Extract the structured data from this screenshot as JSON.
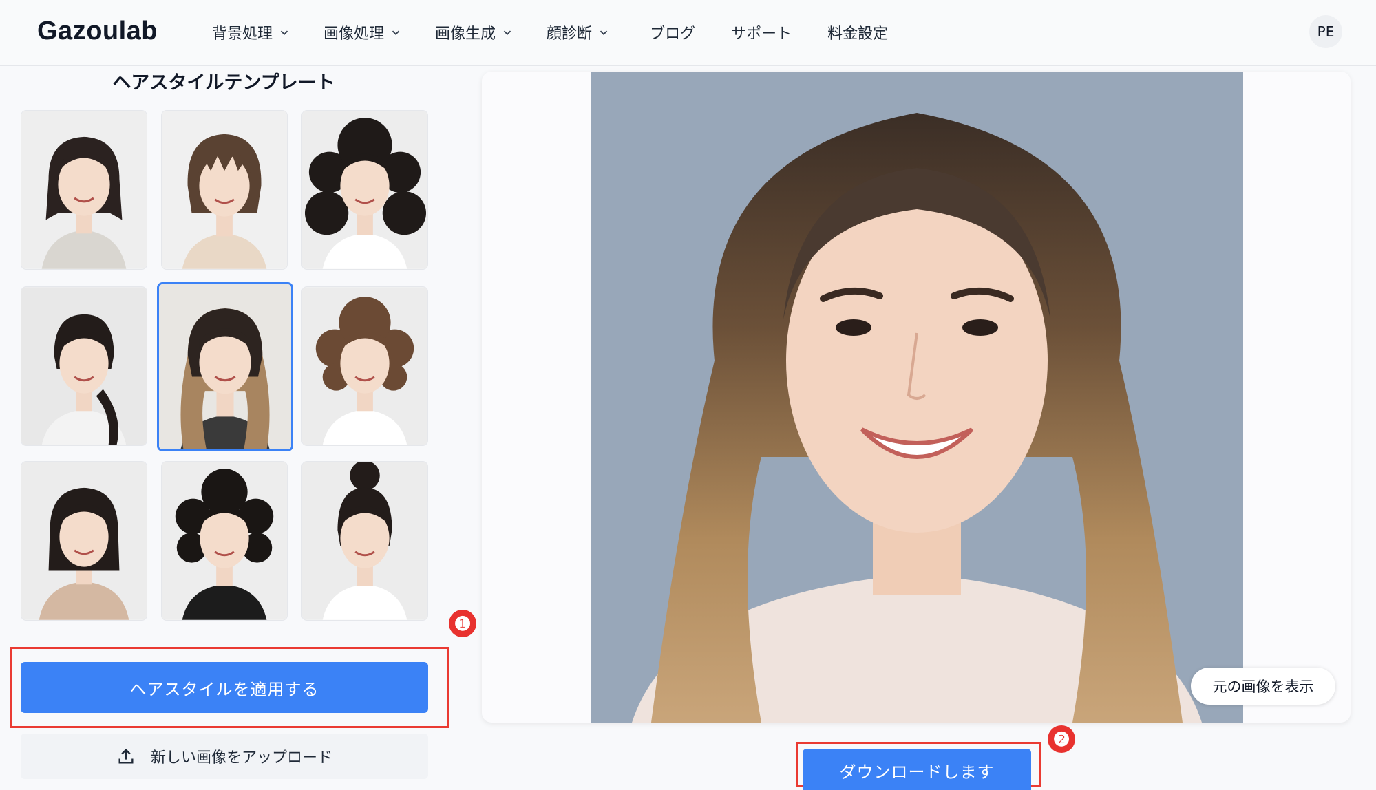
{
  "header": {
    "logo": "Gazoulab",
    "nav": [
      {
        "label": "背景処理",
        "dropdown": true
      },
      {
        "label": "画像処理",
        "dropdown": true
      },
      {
        "label": "画像生成",
        "dropdown": true
      },
      {
        "label": "顔診断",
        "dropdown": true
      },
      {
        "label": "ブログ",
        "dropdown": false
      },
      {
        "label": "サポート",
        "dropdown": false
      },
      {
        "label": "料金設定",
        "dropdown": false
      }
    ],
    "avatar_initials": "PE"
  },
  "left_panel": {
    "title": "ヘアスタイルテンプレート",
    "templates": [
      {
        "style": "short bob",
        "selected": false
      },
      {
        "style": "short shaggy",
        "selected": false
      },
      {
        "style": "long curly",
        "selected": false
      },
      {
        "style": "ponytail",
        "selected": false
      },
      {
        "style": "long wavy highlights",
        "selected": true
      },
      {
        "style": "curly brown",
        "selected": false
      },
      {
        "style": "bob",
        "selected": false
      },
      {
        "style": "short curly",
        "selected": false
      },
      {
        "style": "bun",
        "selected": false
      }
    ],
    "marker_1": "❶",
    "apply_button": "ヘアスタイルを適用する",
    "upload_button": "新しい画像をアップロード"
  },
  "preview": {
    "show_original_button": "元の画像を表示",
    "marker_2": "❷",
    "download_button": "ダウンロードします"
  },
  "colors": {
    "primary": "#3b82f6",
    "annotation_red": "#ea3b32"
  }
}
